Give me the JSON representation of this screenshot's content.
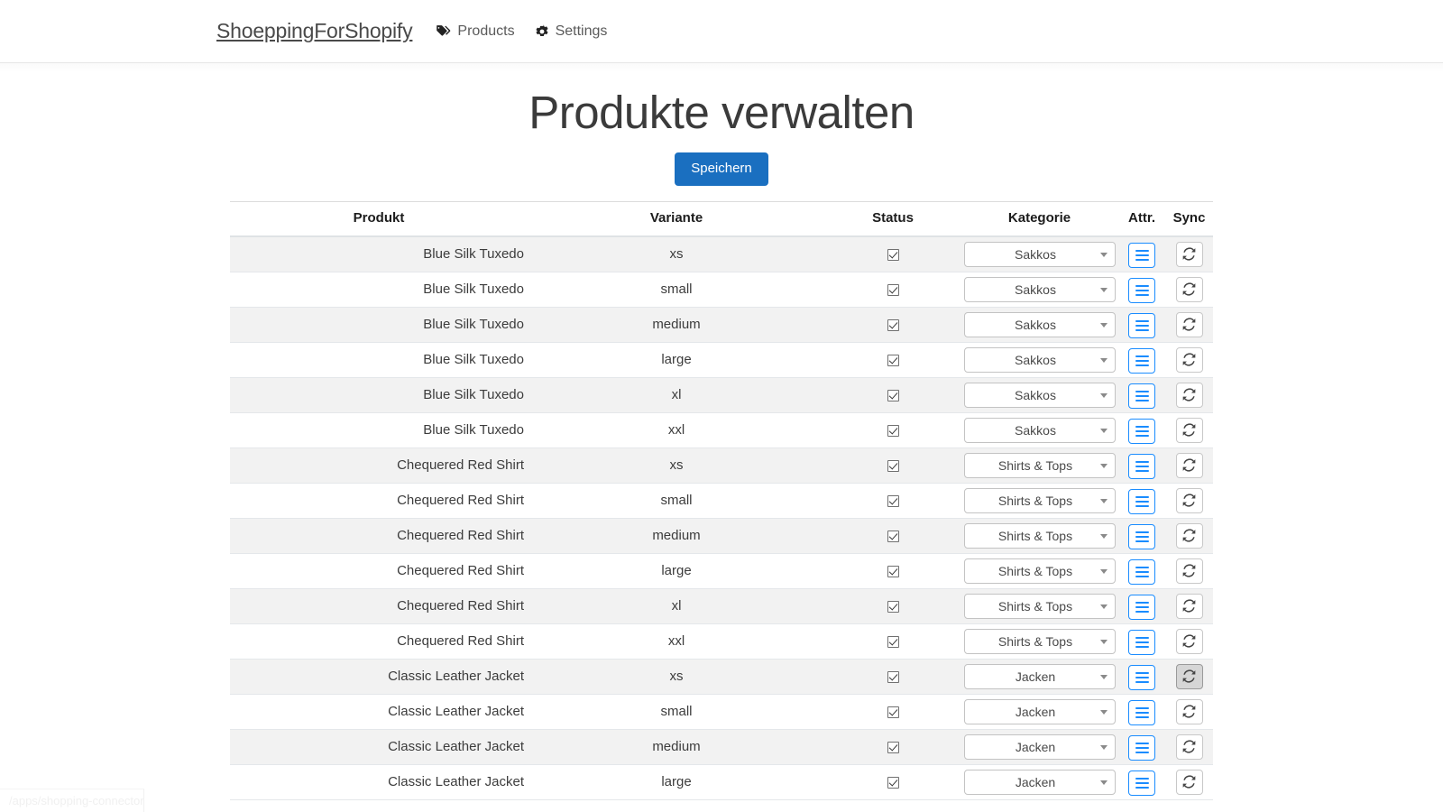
{
  "navbar": {
    "brand": "ShoeppingForShopify",
    "links": [
      {
        "label": "Products",
        "icon": "tag-icon"
      },
      {
        "label": "Settings",
        "icon": "gear-icon"
      }
    ]
  },
  "page": {
    "title": "Produkte verwalten",
    "save_label": "Speichern"
  },
  "table": {
    "headers": {
      "produkt": "Produkt",
      "variante": "Variante",
      "status": "Status",
      "kategorie": "Kategorie",
      "attr": "Attr.",
      "sync": "Sync"
    },
    "rows": [
      {
        "produkt": "Blue Silk Tuxedo",
        "variante": "xs",
        "status": true,
        "kategorie": "Sakkos",
        "attr_icon": "list-icon",
        "sync_icon": "refresh-icon",
        "sync_active": false
      },
      {
        "produkt": "Blue Silk Tuxedo",
        "variante": "small",
        "status": true,
        "kategorie": "Sakkos",
        "attr_icon": "list-icon",
        "sync_icon": "refresh-icon",
        "sync_active": false
      },
      {
        "produkt": "Blue Silk Tuxedo",
        "variante": "medium",
        "status": true,
        "kategorie": "Sakkos",
        "attr_icon": "list-icon",
        "sync_icon": "refresh-icon",
        "sync_active": false
      },
      {
        "produkt": "Blue Silk Tuxedo",
        "variante": "large",
        "status": true,
        "kategorie": "Sakkos",
        "attr_icon": "list-icon",
        "sync_icon": "refresh-icon",
        "sync_active": false
      },
      {
        "produkt": "Blue Silk Tuxedo",
        "variante": "xl",
        "status": true,
        "kategorie": "Sakkos",
        "attr_icon": "list-icon",
        "sync_icon": "refresh-icon",
        "sync_active": false
      },
      {
        "produkt": "Blue Silk Tuxedo",
        "variante": "xxl",
        "status": true,
        "kategorie": "Sakkos",
        "attr_icon": "list-icon",
        "sync_icon": "refresh-icon",
        "sync_active": false
      },
      {
        "produkt": "Chequered Red Shirt",
        "variante": "xs",
        "status": true,
        "kategorie": "Shirts & Tops",
        "attr_icon": "list-icon",
        "sync_icon": "refresh-icon",
        "sync_active": false
      },
      {
        "produkt": "Chequered Red Shirt",
        "variante": "small",
        "status": true,
        "kategorie": "Shirts & Tops",
        "attr_icon": "list-icon",
        "sync_icon": "refresh-icon",
        "sync_active": false
      },
      {
        "produkt": "Chequered Red Shirt",
        "variante": "medium",
        "status": true,
        "kategorie": "Shirts & Tops",
        "attr_icon": "list-icon",
        "sync_icon": "refresh-icon",
        "sync_active": false
      },
      {
        "produkt": "Chequered Red Shirt",
        "variante": "large",
        "status": true,
        "kategorie": "Shirts & Tops",
        "attr_icon": "list-icon",
        "sync_icon": "refresh-icon",
        "sync_active": false
      },
      {
        "produkt": "Chequered Red Shirt",
        "variante": "xl",
        "status": true,
        "kategorie": "Shirts & Tops",
        "attr_icon": "list-icon",
        "sync_icon": "refresh-icon",
        "sync_active": false
      },
      {
        "produkt": "Chequered Red Shirt",
        "variante": "xxl",
        "status": true,
        "kategorie": "Shirts & Tops",
        "attr_icon": "list-icon",
        "sync_icon": "refresh-icon",
        "sync_active": false
      },
      {
        "produkt": "Classic Leather Jacket",
        "variante": "xs",
        "status": true,
        "kategorie": "Jacken",
        "attr_icon": "list-icon",
        "sync_icon": "refresh-icon",
        "sync_active": true
      },
      {
        "produkt": "Classic Leather Jacket",
        "variante": "small",
        "status": true,
        "kategorie": "Jacken",
        "attr_icon": "list-icon",
        "sync_icon": "refresh-icon",
        "sync_active": false
      },
      {
        "produkt": "Classic Leather Jacket",
        "variante": "medium",
        "status": true,
        "kategorie": "Jacken",
        "attr_icon": "list-icon",
        "sync_icon": "refresh-icon",
        "sync_active": false
      },
      {
        "produkt": "Classic Leather Jacket",
        "variante": "large",
        "status": true,
        "kategorie": "Jacken",
        "attr_icon": "list-icon",
        "sync_icon": "refresh-icon",
        "sync_active": false
      }
    ],
    "kategorie_options": [
      "Sakkos",
      "Shirts & Tops",
      "Jacken"
    ]
  },
  "status_bar": {
    "link_preview": "/apps/shopping-connector"
  },
  "colors": {
    "primary": "#1a6fc0",
    "attr_blue": "#1a8cff",
    "row_stripe": "#f2f2f2",
    "text": "#3c3c3c"
  }
}
